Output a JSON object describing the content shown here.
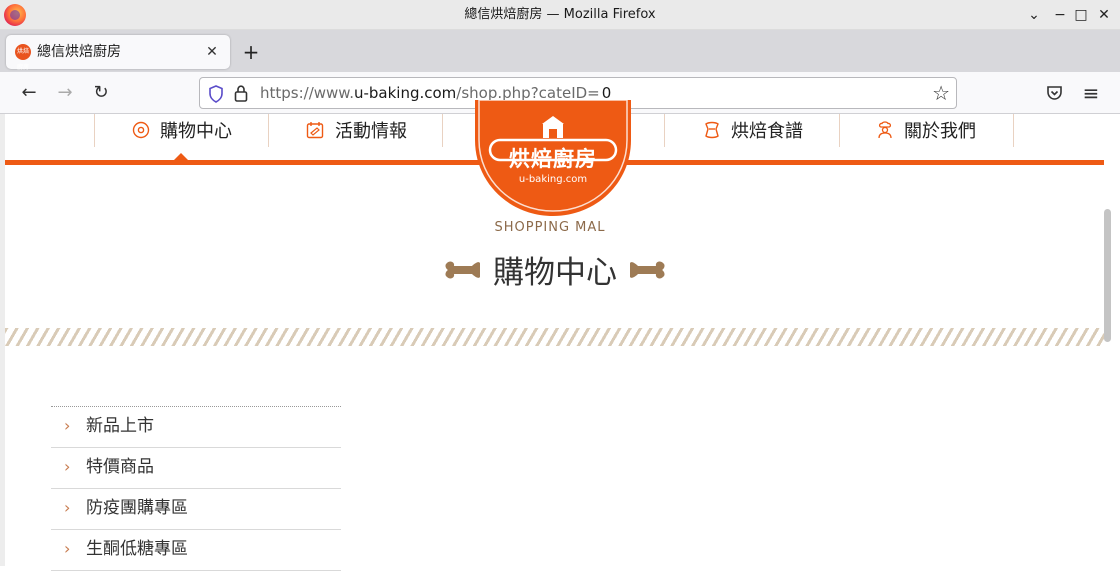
{
  "window": {
    "title": "總信烘焙廚房 — Mozilla Firefox",
    "controls": {
      "minimize": "⌄",
      "restore": "−",
      "maximize": "□",
      "close": "✕"
    }
  },
  "tab": {
    "label": "總信烘焙廚房",
    "favicon_text": "烘焙廚房",
    "close": "✕",
    "new_tab": "+"
  },
  "nav": {
    "back": "←",
    "forward": "→",
    "reload": "↻",
    "url_prefix": "https://www.",
    "url_host": "u-baking.com",
    "url_path": "/shop.php?cateID=",
    "url_highlight": "0",
    "bookmark": "☆",
    "menu": "≡"
  },
  "site": {
    "menu": [
      {
        "label": "購物中心",
        "icon": "donut-icon"
      },
      {
        "label": "活動情報",
        "icon": "calendar-icon"
      },
      {
        "label": "烘焙食譜",
        "icon": "recipe-icon"
      },
      {
        "label": "關於我們",
        "icon": "chef-icon"
      }
    ],
    "logo": {
      "title": "烘焙廚房",
      "domain": "u-baking.com"
    },
    "section_subtitle": "SHOPPING MAL",
    "section_title": "購物中心",
    "categories": [
      "新品上市",
      "特價商品",
      "防疫團購專區",
      "生酮低糖專區"
    ],
    "category_chevron": "›"
  },
  "colors": {
    "brand_orange": "#ee5a14",
    "bone_brown": "#9e7b55"
  }
}
